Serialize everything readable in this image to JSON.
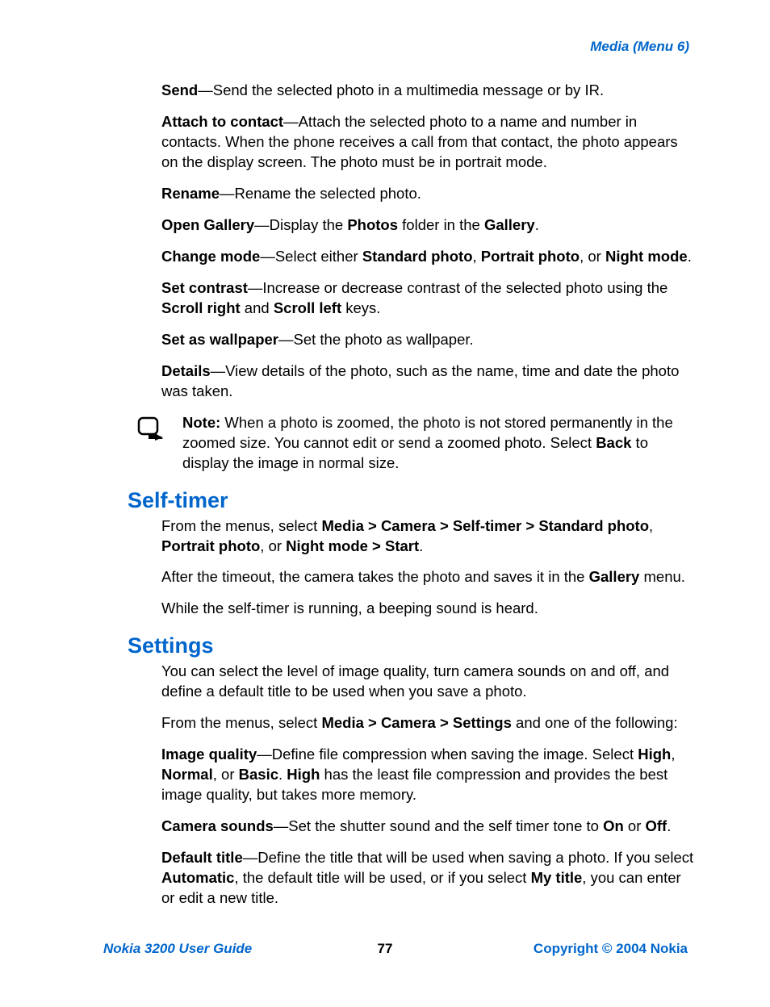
{
  "header": "Media (Menu 6)",
  "defs": {
    "send": {
      "term": "Send",
      "sep": "—",
      "text": "Send the selected photo in a multimedia message or by IR."
    },
    "attach": {
      "term": "Attach to contact",
      "sep": "—",
      "text": "Attach the selected photo to a name and number in contacts. When the phone receives a call from that contact, the photo appears on the display screen. The photo must be in portrait mode."
    },
    "rename": {
      "term": "Rename",
      "sep": "—",
      "text": "Rename the selected photo."
    },
    "opengallery": {
      "term": "Open Gallery",
      "sep": "—",
      "pre": "Display the ",
      "b1": "Photos",
      "mid": " folder in the ",
      "b2": "Gallery",
      "post": "."
    },
    "changemode": {
      "term": "Change mode",
      "sep": "—",
      "pre": "Select either ",
      "b1": "Standard photo",
      "c1": ", ",
      "b2": "Portrait photo",
      "c2": ", or ",
      "b3": "Night mode",
      "post": "."
    },
    "setcontrast": {
      "term": "Set contrast",
      "sep": "—",
      "pre": "Increase or decrease contrast of the selected photo using the ",
      "b1": "Scroll right",
      "mid": " and ",
      "b2": "Scroll left",
      "post": " keys."
    },
    "wallpaper": {
      "term": "Set as wallpaper",
      "sep": "—",
      "text": "Set the photo as wallpaper."
    },
    "details": {
      "term": "Details",
      "sep": "—",
      "text": "View details of the photo, such as the name, time and date the photo was taken."
    }
  },
  "note": {
    "label": "Note:",
    "pre": " When a photo is zoomed, the photo is not stored permanently in the zoomed size. You cannot edit or send a zoomed photo. Select ",
    "b1": "Back",
    "post": " to display the image in normal size."
  },
  "h2a": "Self-timer",
  "selftimer": {
    "p1_pre": "From the menus, select ",
    "p1_b1": "Media > Camera > Self-timer > Standard photo",
    "p1_c1": ", ",
    "p1_b2": "Portrait photo",
    "p1_c2": ", or ",
    "p1_b3": "Night mode > Start",
    "p1_post": ".",
    "p2_pre": "After the timeout, the camera takes the photo and saves it in the ",
    "p2_b1": "Gallery",
    "p2_post": " menu.",
    "p3": "While the self-timer is running, a beeping sound is heard."
  },
  "h2b": "Settings",
  "settings": {
    "p1": "You can select the level of image quality, turn camera sounds on and off, and define a default title to be used when you save a photo.",
    "p2_pre": "From the menus, select ",
    "p2_b1": "Media > Camera > Settings",
    "p2_post": " and one of the following:",
    "iq": {
      "term": "Image quality",
      "sep": "—",
      "pre": "Define file compression when saving the image. Select ",
      "b1": "High",
      "c1": ", ",
      "b2": "Normal",
      "c2": ", or ",
      "b3": "Basic",
      "c3": ". ",
      "b4": "High",
      "post": " has the least file compression and provides the best image quality, but takes more memory."
    },
    "cs": {
      "term": "Camera sounds",
      "sep": "—",
      "pre": "Set the shutter sound and the self timer tone to ",
      "b1": "On",
      "mid": " or ",
      "b2": "Off",
      "post": "."
    },
    "dt": {
      "term": "Default title",
      "sep": "—",
      "pre": "Define the title that will be used when saving a photo. If you select ",
      "b1": "Automatic",
      "mid": ", the default title will be used, or if you select ",
      "b2": "My title",
      "post": ", you can enter or edit a new title."
    }
  },
  "footer": {
    "guide": "Nokia 3200 User Guide",
    "page": "77",
    "copyright": "Copyright © 2004 Nokia"
  }
}
